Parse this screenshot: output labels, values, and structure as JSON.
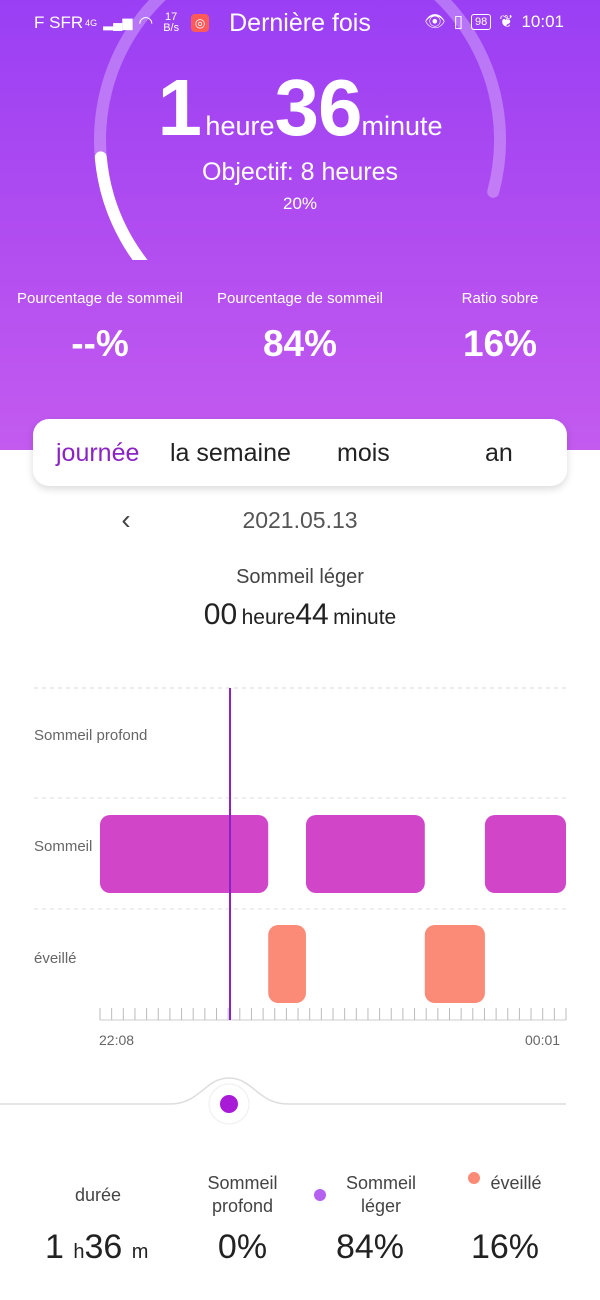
{
  "status_bar": {
    "carrier": "F SFR",
    "network": "4G",
    "speed_value": "17",
    "speed_unit": "B/s",
    "time": "10:01",
    "battery": "98"
  },
  "header": {
    "title": "Dernière fois"
  },
  "summary": {
    "hours": "1",
    "hours_unit": "heure",
    "minutes": "36",
    "minutes_unit": "minute",
    "goal_text": "Objectif: 8 heures",
    "goal_percent_text": "20%",
    "goal_progress": 0.2
  },
  "stats": [
    {
      "label": "Pourcentage de sommeil",
      "value": "--%"
    },
    {
      "label": "Pourcentage de sommeil",
      "value": "84%"
    },
    {
      "label": "Ratio sobre",
      "value": "16%"
    }
  ],
  "tabs": [
    {
      "label": "journée",
      "active": true
    },
    {
      "label": "la semaine",
      "active": false
    },
    {
      "label": "mois",
      "active": false
    },
    {
      "label": "an",
      "active": false
    }
  ],
  "date_nav": {
    "date": "2021.05.13"
  },
  "selection": {
    "stage": "Sommeil léger",
    "hours": "00",
    "hours_unit": "heure",
    "minutes": "44",
    "minutes_unit": "minute"
  },
  "chart_data": {
    "type": "timeline",
    "y_levels": [
      "Sommeil profond",
      "Sommeil",
      "éveillé"
    ],
    "x_start_label": "22:08",
    "x_end_label": "00:01",
    "segments": [
      {
        "stage": "Sommeil",
        "start": 0.0,
        "end": 0.361
      },
      {
        "stage": "éveillé",
        "start": 0.361,
        "end": 0.442
      },
      {
        "stage": "Sommeil",
        "start": 0.442,
        "end": 0.697
      },
      {
        "stage": "éveillé",
        "start": 0.697,
        "end": 0.826
      },
      {
        "stage": "Sommeil",
        "start": 0.826,
        "end": 1.0
      }
    ],
    "cursor_position": 0.279,
    "colors": {
      "sleep": "#d145c9",
      "awake": "#fb8b76",
      "cursor": "#8a22c4"
    }
  },
  "legend": {
    "duration_label": "durée",
    "duration_hours": "1",
    "duration_hours_unit": "h",
    "duration_minutes": "36",
    "duration_minutes_unit": "m",
    "items": [
      {
        "label": "Sommeil profond",
        "value": "0%",
        "color": "#8a32e0"
      },
      {
        "label": "Sommeil léger",
        "value": "84%",
        "color": "#b561f0"
      },
      {
        "label": "éveillé",
        "value": "16%",
        "color": "#fb8b76"
      }
    ]
  },
  "colors": {
    "accent": "#8a22c4",
    "hero_top": "#9a3ff4",
    "hero_bottom": "#c35bef"
  }
}
